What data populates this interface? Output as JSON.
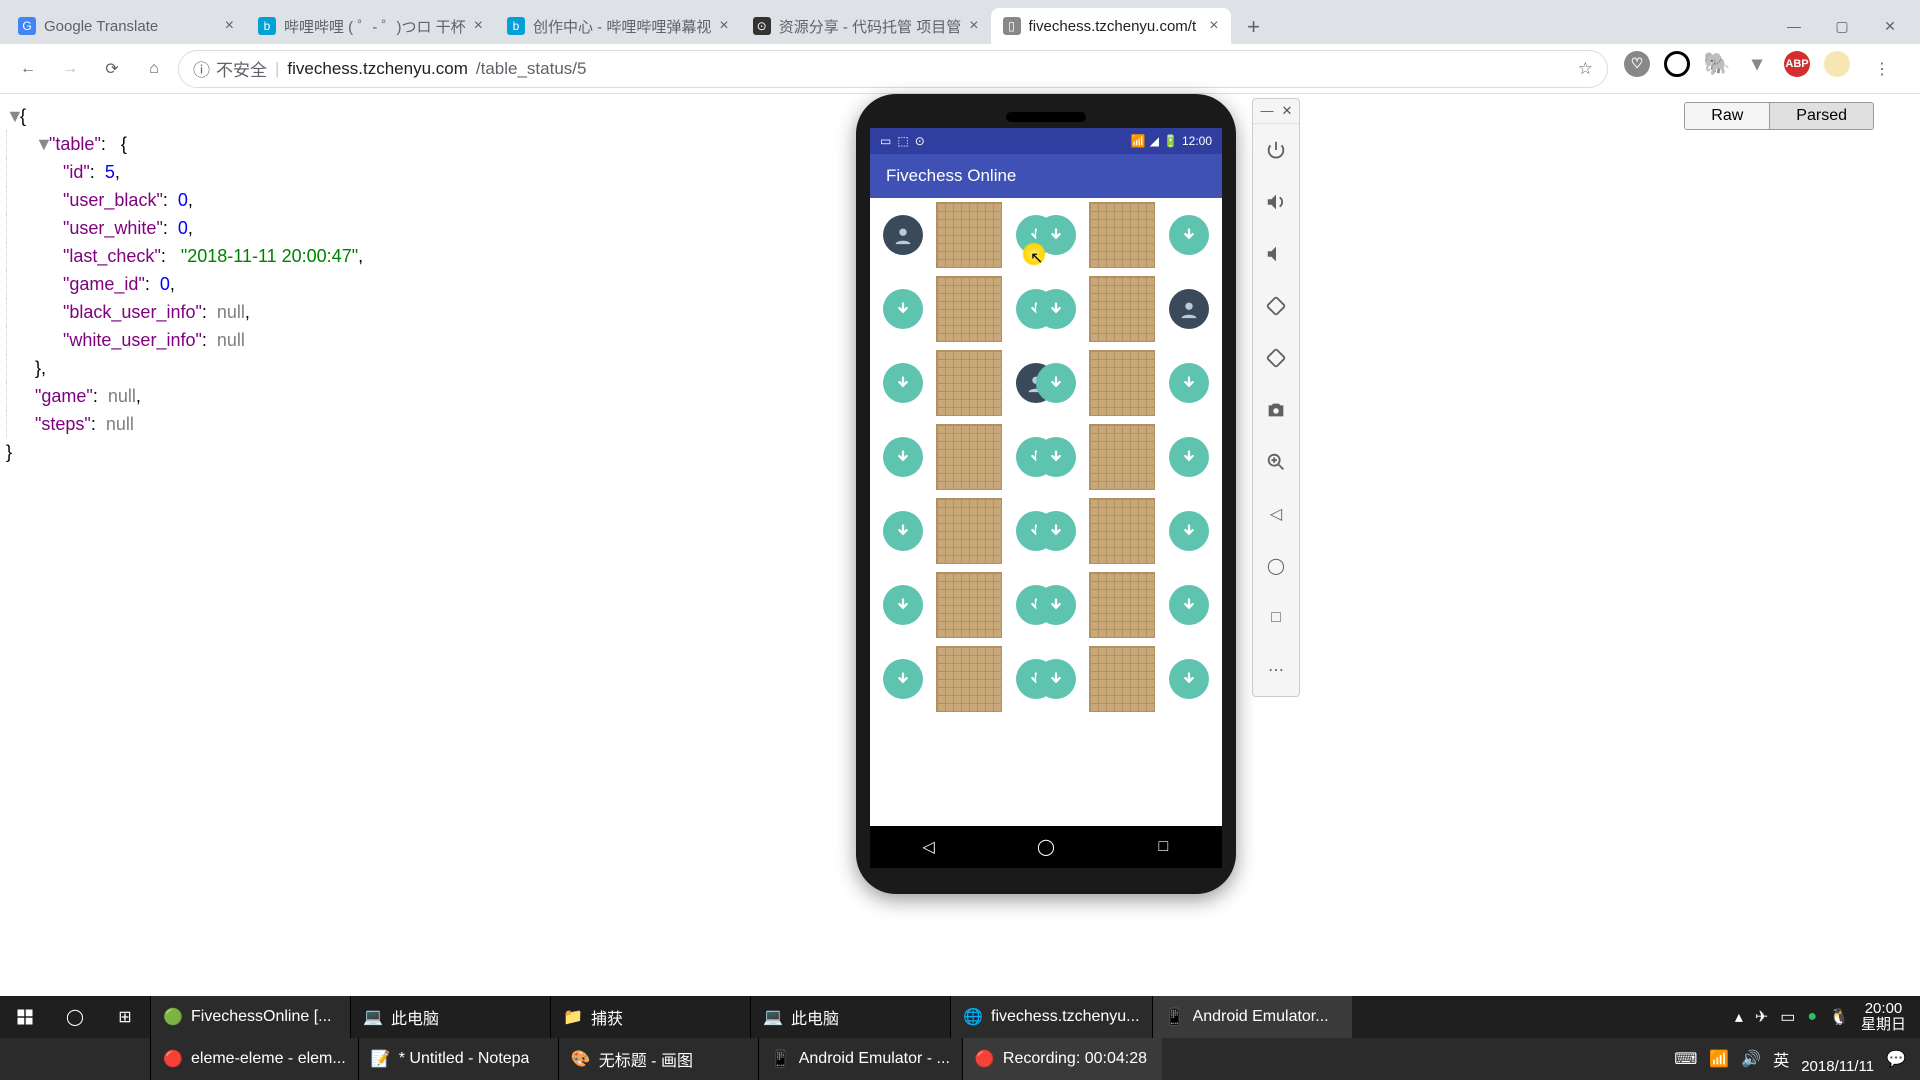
{
  "browser": {
    "tabs": [
      {
        "label": "Google Translate",
        "favicon_bg": "#4285f4",
        "favicon_txt": "G"
      },
      {
        "label": "哔哩哔哩 ( ゜- ゜)つロ 干杯",
        "favicon_bg": "#00a1d6",
        "favicon_txt": "b"
      },
      {
        "label": "创作中心 - 哔哩哔哩弹幕视",
        "favicon_bg": "#00a1d6",
        "favicon_txt": "b"
      },
      {
        "label": "资源分享 - 代码托管 项目管",
        "favicon_bg": "#333",
        "favicon_txt": "⊙"
      },
      {
        "label": "fivechess.tzchenyu.com/t",
        "favicon_bg": "#888",
        "favicon_txt": "▯",
        "active": true
      }
    ],
    "addr_insecure": "不安全",
    "addr_host": "fivechess.tzchenyu.com",
    "addr_path": "/table_status/5",
    "toggle_raw": "Raw",
    "toggle_parsed": "Parsed"
  },
  "json": {
    "table_key": "table",
    "id_key": "id",
    "id_val": "5",
    "ub_key": "user_black",
    "ub_val": "0",
    "uw_key": "user_white",
    "uw_val": "0",
    "lc_key": "last_check",
    "lc_val": "\"2018-11-11 20:00:47\"",
    "gid_key": "game_id",
    "gid_val": "0",
    "bui_key": "black_user_info",
    "bui_val": "null",
    "wui_key": "white_user_info",
    "wui_val": "null",
    "game_key": "game",
    "game_val": "null",
    "steps_key": "steps",
    "steps_val": "null"
  },
  "emulator": {
    "app_title": "Fivechess Online",
    "status_time": "12:00",
    "rows": [
      [
        "user",
        "open",
        "open"
      ],
      [
        "open",
        "open",
        "user"
      ],
      [
        "open",
        "user",
        "open"
      ],
      [
        "open",
        "open",
        "open"
      ],
      [
        "open",
        "open",
        "open"
      ],
      [
        "open",
        "open",
        "open"
      ],
      [
        "open",
        "open",
        "open"
      ]
    ]
  },
  "taskbar": {
    "row1": [
      {
        "icon": "🟢",
        "label": "FivechessOnline [...",
        "bg": "#2b2b2b"
      },
      {
        "icon": "💻",
        "label": "此电脑"
      },
      {
        "icon": "📁",
        "label": "捕获"
      },
      {
        "icon": "💻",
        "label": "此电脑"
      },
      {
        "icon": "🌐",
        "label": "fivechess.tzchenyu...",
        "bg": "#2b2b2b"
      },
      {
        "icon": "📱",
        "label": "Android Emulator...",
        "active": true
      }
    ],
    "row2": [
      {
        "icon": "🔴",
        "label": "eleme-eleme - elem..."
      },
      {
        "icon": "📝",
        "label": "* Untitled - Notepa"
      },
      {
        "icon": "🎨",
        "label": "无标题 - 画图"
      },
      {
        "icon": "📱",
        "label": "Android Emulator - ..."
      },
      {
        "icon": "🔴",
        "label": "Recording:  00:04:28",
        "bg": "#3a3a3a"
      }
    ],
    "ime": "英",
    "time": "20:00",
    "weekday": "星期日",
    "date": "2018/11/11"
  }
}
